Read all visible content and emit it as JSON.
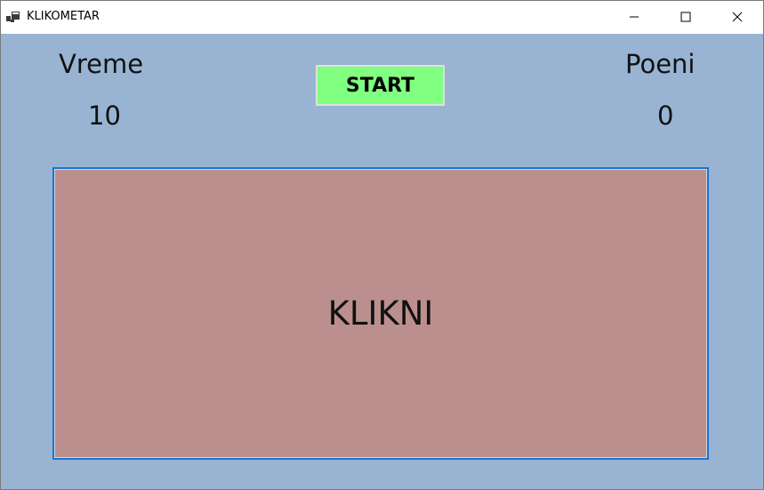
{
  "window": {
    "title": "KLIKOMETAR",
    "icon": "app-window-icon"
  },
  "titlebar_controls": {
    "minimize_icon": "minimize-icon",
    "maximize_icon": "maximize-icon",
    "close_icon": "close-icon"
  },
  "time": {
    "label": "Vreme",
    "value": "10"
  },
  "score": {
    "label": "Poeni",
    "value": "0"
  },
  "start_button": {
    "label": "START",
    "color": "#80ff80"
  },
  "click_area": {
    "label": "KLIKNI",
    "color": "#bc8f8f"
  },
  "colors": {
    "background": "#98b4d2",
    "focus_border": "#1976d2"
  }
}
